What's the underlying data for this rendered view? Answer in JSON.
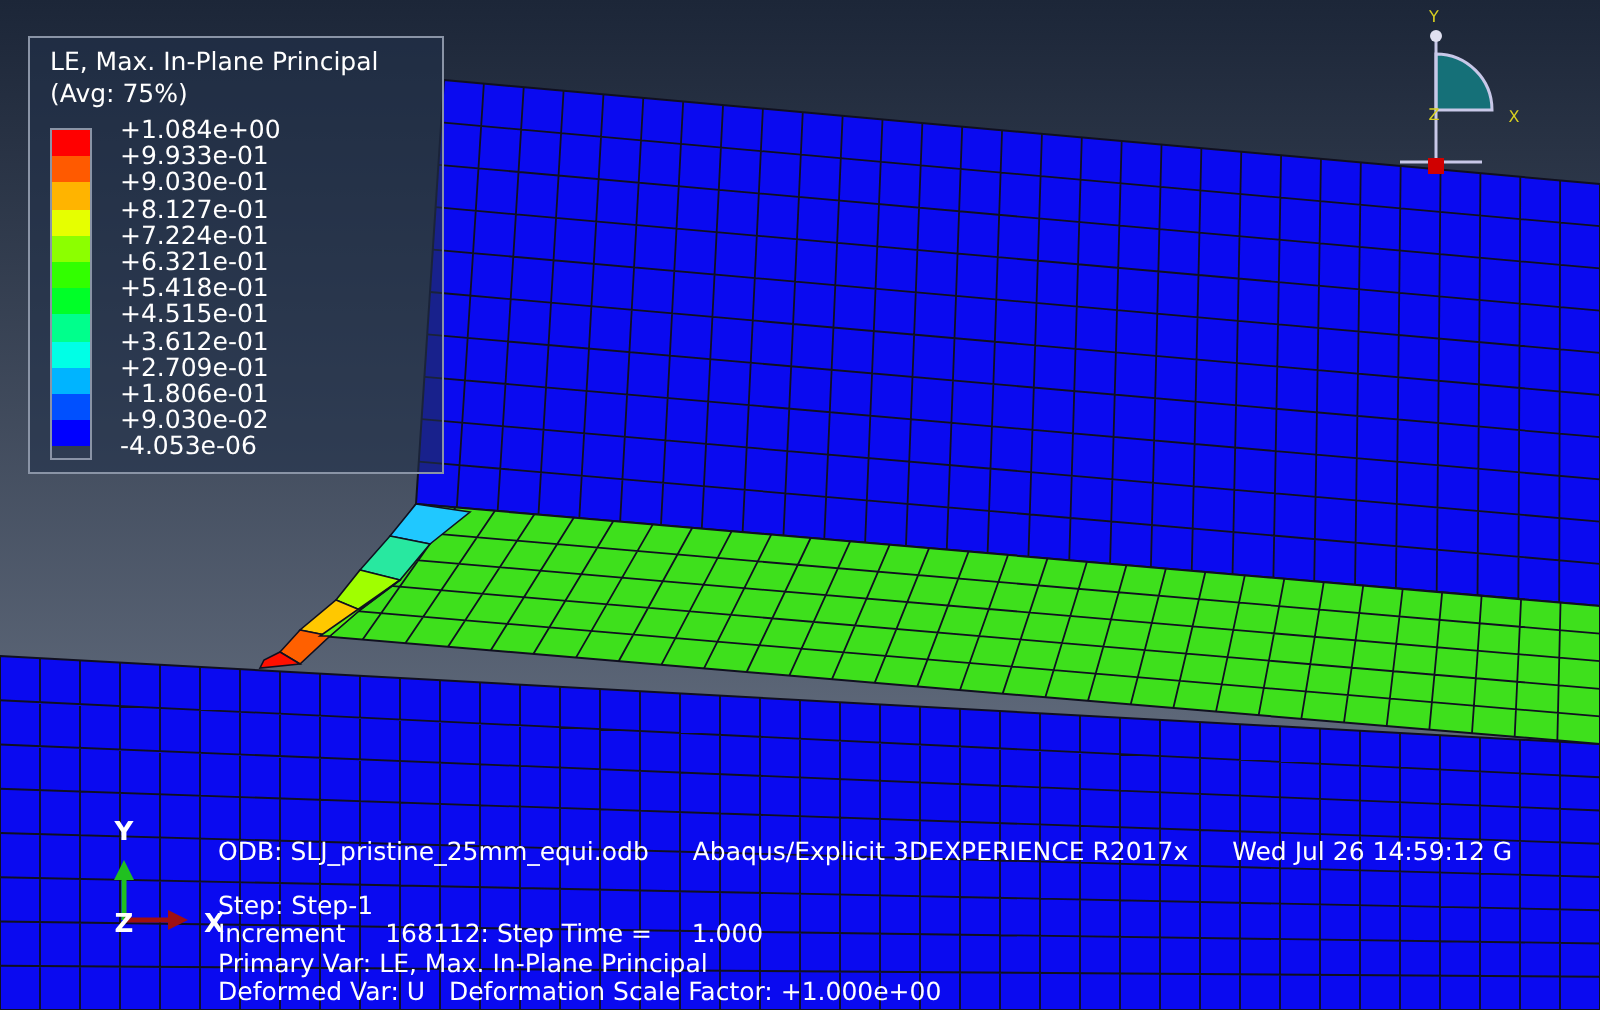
{
  "legend": {
    "title_lines": [
      "LE, Max. In-Plane Principal",
      "(Avg: 75%)"
    ],
    "bands": [
      {
        "color": "#ff0000"
      },
      {
        "color": "#ff5a00"
      },
      {
        "color": "#ffb400"
      },
      {
        "color": "#e6ff00"
      },
      {
        "color": "#8cff00"
      },
      {
        "color": "#32ff00"
      },
      {
        "color": "#00ff28"
      },
      {
        "color": "#00ff8c"
      },
      {
        "color": "#00ffe6"
      },
      {
        "color": "#00b4ff"
      },
      {
        "color": "#0050ff"
      },
      {
        "color": "#0000ff"
      }
    ],
    "ticks": [
      "+1.084e+00",
      "+9.933e-01",
      "+9.030e-01",
      "+8.127e-01",
      "+7.224e-01",
      "+6.321e-01",
      "+5.418e-01",
      "+4.515e-01",
      "+3.612e-01",
      "+2.709e-01",
      "+1.806e-01",
      "+9.030e-02",
      "-4.053e-06"
    ]
  },
  "view_triad": {
    "y": "Y",
    "x": "X",
    "z": "Z"
  },
  "axis_triad": {
    "y": "Y",
    "z": "Z",
    "x": "X"
  },
  "info": {
    "odb": "ODB: SLJ_pristine_25mm_equi.odb",
    "solver": "Abaqus/Explicit 3DEXPERIENCE R2017x",
    "date": "Wed Jul 26 14:59:12 G",
    "lines": [
      "Step: Step-1",
      "Increment     168112: Step Time =     1.000",
      "Primary Var: LE, Max. In-Plane Principal",
      "Deformed Var: U   Deformation Scale Factor: +1.000e+00"
    ]
  }
}
